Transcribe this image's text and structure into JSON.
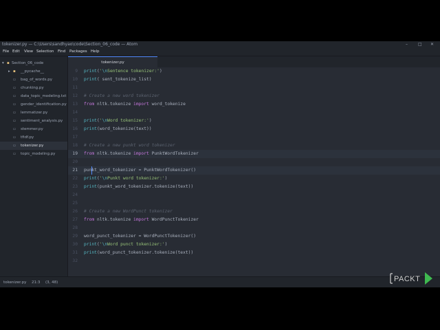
{
  "window": {
    "title": "tokenizer.py — C:\\Users\\sandhyao\\code\\Section_06_code — Atom",
    "controls": [
      "–",
      "□",
      "✕"
    ]
  },
  "menu": [
    "File",
    "Edit",
    "View",
    "Selection",
    "Find",
    "Packages",
    "Help"
  ],
  "sidebar": {
    "root": "Section_06_code",
    "items": [
      {
        "label": "__pycache__",
        "type": "folder"
      },
      {
        "label": "bag_of_words.py",
        "type": "file"
      },
      {
        "label": "chunking.py",
        "type": "file"
      },
      {
        "label": "data_topic_modeling.txt",
        "type": "file"
      },
      {
        "label": "gender_identification.py",
        "type": "file"
      },
      {
        "label": "lemmatizer.py",
        "type": "file"
      },
      {
        "label": "sentiment_analysis.py",
        "type": "file"
      },
      {
        "label": "stemmer.py",
        "type": "file"
      },
      {
        "label": "tfidf.py",
        "type": "file"
      },
      {
        "label": "tokenizer.py",
        "type": "file",
        "selected": true
      },
      {
        "label": "topic_modeling.py",
        "type": "file"
      }
    ]
  },
  "tab": {
    "label": "tokenizer.py"
  },
  "editor": {
    "current_line": 21,
    "lines": [
      {
        "n": "9",
        "tokens": [
          [
            "fn",
            "print"
          ],
          [
            "pl",
            "("
          ],
          [
            "str",
            "'"
          ],
          [
            "esc",
            "\\n"
          ],
          [
            "str",
            "Sentence tokenizer:'"
          ],
          [
            "pl",
            ")"
          ]
        ]
      },
      {
        "n": "10",
        "tokens": [
          [
            "fn",
            "print"
          ],
          [
            "pl",
            "( sent_tokenize_list)"
          ]
        ]
      },
      {
        "n": "11",
        "tokens": []
      },
      {
        "n": "12",
        "tokens": [
          [
            "cm",
            "# Create a new word tokenizer"
          ]
        ]
      },
      {
        "n": "13",
        "tokens": [
          [
            "kw",
            "from"
          ],
          [
            "pl",
            " nltk.tokenize "
          ],
          [
            "kw",
            "import"
          ],
          [
            "pl",
            " word_tokenize"
          ]
        ]
      },
      {
        "n": "14",
        "tokens": []
      },
      {
        "n": "15",
        "tokens": [
          [
            "fn",
            "print"
          ],
          [
            "pl",
            "("
          ],
          [
            "str",
            "'"
          ],
          [
            "esc",
            "\\n"
          ],
          [
            "str",
            "Word tokenizer:'"
          ],
          [
            "pl",
            ")"
          ]
        ]
      },
      {
        "n": "16",
        "tokens": [
          [
            "fn",
            "print"
          ],
          [
            "pl",
            "(word_tokenize(text))"
          ]
        ]
      },
      {
        "n": "17",
        "tokens": []
      },
      {
        "n": "18",
        "tokens": [
          [
            "cm",
            "# Create a new punkt word tokenizer"
          ]
        ]
      },
      {
        "n": "19",
        "tokens": [
          [
            "kw",
            "from"
          ],
          [
            "pl",
            " nltk.tokenize "
          ],
          [
            "kw",
            "import"
          ],
          [
            "pl",
            " PunktWordTokenizer"
          ]
        ]
      },
      {
        "n": "20",
        "tokens": []
      },
      {
        "n": "21",
        "tokens": [
          [
            "pl",
            "punkt_word_tokenizer = PunktWordTokenizer()"
          ]
        ]
      },
      {
        "n": "22",
        "tokens": [
          [
            "fn",
            "print"
          ],
          [
            "pl",
            "("
          ],
          [
            "str",
            "'"
          ],
          [
            "esc",
            "\\n"
          ],
          [
            "str",
            "Punkt word tokenizer:'"
          ],
          [
            "pl",
            ")"
          ]
        ]
      },
      {
        "n": "23",
        "tokens": [
          [
            "fn",
            "print"
          ],
          [
            "pl",
            "(punkt_word_tokenizer.tokenize(text))"
          ]
        ]
      },
      {
        "n": "24",
        "tokens": []
      },
      {
        "n": "25",
        "tokens": []
      },
      {
        "n": "26",
        "tokens": [
          [
            "cm",
            "# Create a new WordPunct tokenizer"
          ]
        ]
      },
      {
        "n": "27",
        "tokens": [
          [
            "kw",
            "from"
          ],
          [
            "pl",
            " nltk.tokenize "
          ],
          [
            "kw",
            "import"
          ],
          [
            "pl",
            " WordPunctTokenizer"
          ]
        ]
      },
      {
        "n": "28",
        "tokens": []
      },
      {
        "n": "29",
        "tokens": [
          [
            "pl",
            "word_punct_tokenizer = WordPunctTokenizer()"
          ]
        ]
      },
      {
        "n": "30",
        "tokens": [
          [
            "fn",
            "print"
          ],
          [
            "pl",
            "("
          ],
          [
            "str",
            "'"
          ],
          [
            "esc",
            "\\n"
          ],
          [
            "str",
            "Word punct tokenizer:'"
          ],
          [
            "pl",
            ")"
          ]
        ]
      },
      {
        "n": "31",
        "tokens": [
          [
            "fn",
            "print"
          ],
          [
            "pl",
            "(word_punct_tokenizer.tokenize(text))"
          ]
        ]
      },
      {
        "n": "32",
        "tokens": []
      }
    ]
  },
  "status": {
    "file": "tokenizer.py",
    "cursor": "21:3",
    "selection": "(3, 48)"
  },
  "logo": {
    "text": "PACKT",
    "play_color": "#3fb950"
  },
  "colors": {
    "bg": "#282c34",
    "chrome": "#21252b",
    "accent": "#528bff"
  }
}
